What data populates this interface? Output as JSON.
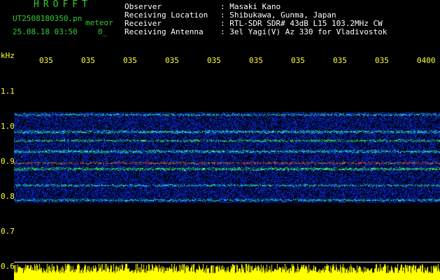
{
  "header": {
    "app_title": "HROFFT",
    "filename": "UT2508180350.pn",
    "file_suffix": "meteor",
    "datetime": "25.08.18 03:50",
    "counter": "0_"
  },
  "info": [
    {
      "label": "Observer",
      "value": ": Masaki Kano"
    },
    {
      "label": "Receiving Location",
      "value": ": Shibukawa, Gunma, Japan"
    },
    {
      "label": "Receiver",
      "value": ": RTL-SDR SDR# 43dB L15 103.2MHz CW"
    },
    {
      "label": "Receiving Antenna",
      "value": ": 3el Yagi(V) Az 330 for Vladivostok"
    }
  ],
  "axis": {
    "y_unit": "kHz",
    "x_ticks": [
      "035",
      "035",
      "035",
      "035",
      "035",
      "035",
      "035",
      "035",
      "035",
      "0400"
    ],
    "y_ticks": [
      "1.1",
      "1.0",
      "0.9",
      "0.8",
      "0.7",
      "0.6"
    ]
  },
  "colors": {
    "background": "#000000",
    "plot_background": "#00003a",
    "text_green": "#33cc33",
    "text_white": "#ffffff",
    "text_yellow": "#ffff33",
    "signal_blue": "#1e3cff",
    "signal_cyan": "#22e0ff",
    "signal_green": "#33ff66",
    "signal_red": "#ff3333",
    "noise_yellow": "#ffff00"
  }
}
